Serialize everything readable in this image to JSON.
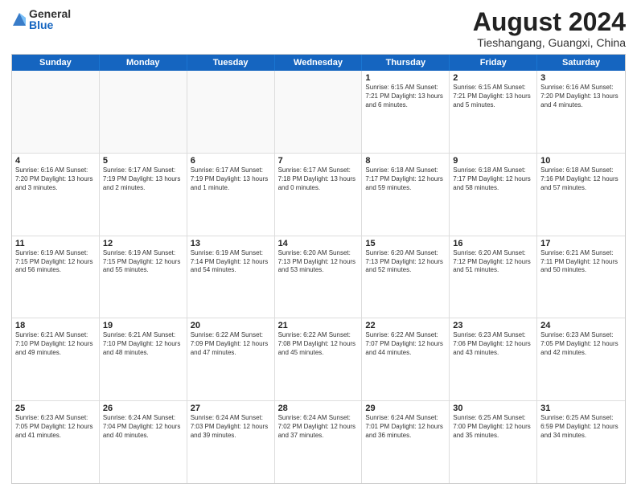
{
  "logo": {
    "general": "General",
    "blue": "Blue"
  },
  "title": "August 2024",
  "location": "Tieshangang, Guangxi, China",
  "header_days": [
    "Sunday",
    "Monday",
    "Tuesday",
    "Wednesday",
    "Thursday",
    "Friday",
    "Saturday"
  ],
  "rows": [
    [
      {
        "day": "",
        "info": "",
        "empty": true
      },
      {
        "day": "",
        "info": "",
        "empty": true
      },
      {
        "day": "",
        "info": "",
        "empty": true
      },
      {
        "day": "",
        "info": "",
        "empty": true
      },
      {
        "day": "1",
        "info": "Sunrise: 6:15 AM\nSunset: 7:21 PM\nDaylight: 13 hours\nand 6 minutes.",
        "empty": false
      },
      {
        "day": "2",
        "info": "Sunrise: 6:15 AM\nSunset: 7:21 PM\nDaylight: 13 hours\nand 5 minutes.",
        "empty": false
      },
      {
        "day": "3",
        "info": "Sunrise: 6:16 AM\nSunset: 7:20 PM\nDaylight: 13 hours\nand 4 minutes.",
        "empty": false
      }
    ],
    [
      {
        "day": "4",
        "info": "Sunrise: 6:16 AM\nSunset: 7:20 PM\nDaylight: 13 hours\nand 3 minutes.",
        "empty": false
      },
      {
        "day": "5",
        "info": "Sunrise: 6:17 AM\nSunset: 7:19 PM\nDaylight: 13 hours\nand 2 minutes.",
        "empty": false
      },
      {
        "day": "6",
        "info": "Sunrise: 6:17 AM\nSunset: 7:19 PM\nDaylight: 13 hours\nand 1 minute.",
        "empty": false
      },
      {
        "day": "7",
        "info": "Sunrise: 6:17 AM\nSunset: 7:18 PM\nDaylight: 13 hours\nand 0 minutes.",
        "empty": false
      },
      {
        "day": "8",
        "info": "Sunrise: 6:18 AM\nSunset: 7:17 PM\nDaylight: 12 hours\nand 59 minutes.",
        "empty": false
      },
      {
        "day": "9",
        "info": "Sunrise: 6:18 AM\nSunset: 7:17 PM\nDaylight: 12 hours\nand 58 minutes.",
        "empty": false
      },
      {
        "day": "10",
        "info": "Sunrise: 6:18 AM\nSunset: 7:16 PM\nDaylight: 12 hours\nand 57 minutes.",
        "empty": false
      }
    ],
    [
      {
        "day": "11",
        "info": "Sunrise: 6:19 AM\nSunset: 7:15 PM\nDaylight: 12 hours\nand 56 minutes.",
        "empty": false
      },
      {
        "day": "12",
        "info": "Sunrise: 6:19 AM\nSunset: 7:15 PM\nDaylight: 12 hours\nand 55 minutes.",
        "empty": false
      },
      {
        "day": "13",
        "info": "Sunrise: 6:19 AM\nSunset: 7:14 PM\nDaylight: 12 hours\nand 54 minutes.",
        "empty": false
      },
      {
        "day": "14",
        "info": "Sunrise: 6:20 AM\nSunset: 7:13 PM\nDaylight: 12 hours\nand 53 minutes.",
        "empty": false
      },
      {
        "day": "15",
        "info": "Sunrise: 6:20 AM\nSunset: 7:13 PM\nDaylight: 12 hours\nand 52 minutes.",
        "empty": false
      },
      {
        "day": "16",
        "info": "Sunrise: 6:20 AM\nSunset: 7:12 PM\nDaylight: 12 hours\nand 51 minutes.",
        "empty": false
      },
      {
        "day": "17",
        "info": "Sunrise: 6:21 AM\nSunset: 7:11 PM\nDaylight: 12 hours\nand 50 minutes.",
        "empty": false
      }
    ],
    [
      {
        "day": "18",
        "info": "Sunrise: 6:21 AM\nSunset: 7:10 PM\nDaylight: 12 hours\nand 49 minutes.",
        "empty": false
      },
      {
        "day": "19",
        "info": "Sunrise: 6:21 AM\nSunset: 7:10 PM\nDaylight: 12 hours\nand 48 minutes.",
        "empty": false
      },
      {
        "day": "20",
        "info": "Sunrise: 6:22 AM\nSunset: 7:09 PM\nDaylight: 12 hours\nand 47 minutes.",
        "empty": false
      },
      {
        "day": "21",
        "info": "Sunrise: 6:22 AM\nSunset: 7:08 PM\nDaylight: 12 hours\nand 45 minutes.",
        "empty": false
      },
      {
        "day": "22",
        "info": "Sunrise: 6:22 AM\nSunset: 7:07 PM\nDaylight: 12 hours\nand 44 minutes.",
        "empty": false
      },
      {
        "day": "23",
        "info": "Sunrise: 6:23 AM\nSunset: 7:06 PM\nDaylight: 12 hours\nand 43 minutes.",
        "empty": false
      },
      {
        "day": "24",
        "info": "Sunrise: 6:23 AM\nSunset: 7:05 PM\nDaylight: 12 hours\nand 42 minutes.",
        "empty": false
      }
    ],
    [
      {
        "day": "25",
        "info": "Sunrise: 6:23 AM\nSunset: 7:05 PM\nDaylight: 12 hours\nand 41 minutes.",
        "empty": false
      },
      {
        "day": "26",
        "info": "Sunrise: 6:24 AM\nSunset: 7:04 PM\nDaylight: 12 hours\nand 40 minutes.",
        "empty": false
      },
      {
        "day": "27",
        "info": "Sunrise: 6:24 AM\nSunset: 7:03 PM\nDaylight: 12 hours\nand 39 minutes.",
        "empty": false
      },
      {
        "day": "28",
        "info": "Sunrise: 6:24 AM\nSunset: 7:02 PM\nDaylight: 12 hours\nand 37 minutes.",
        "empty": false
      },
      {
        "day": "29",
        "info": "Sunrise: 6:24 AM\nSunset: 7:01 PM\nDaylight: 12 hours\nand 36 minutes.",
        "empty": false
      },
      {
        "day": "30",
        "info": "Sunrise: 6:25 AM\nSunset: 7:00 PM\nDaylight: 12 hours\nand 35 minutes.",
        "empty": false
      },
      {
        "day": "31",
        "info": "Sunrise: 6:25 AM\nSunset: 6:59 PM\nDaylight: 12 hours\nand 34 minutes.",
        "empty": false
      }
    ]
  ]
}
